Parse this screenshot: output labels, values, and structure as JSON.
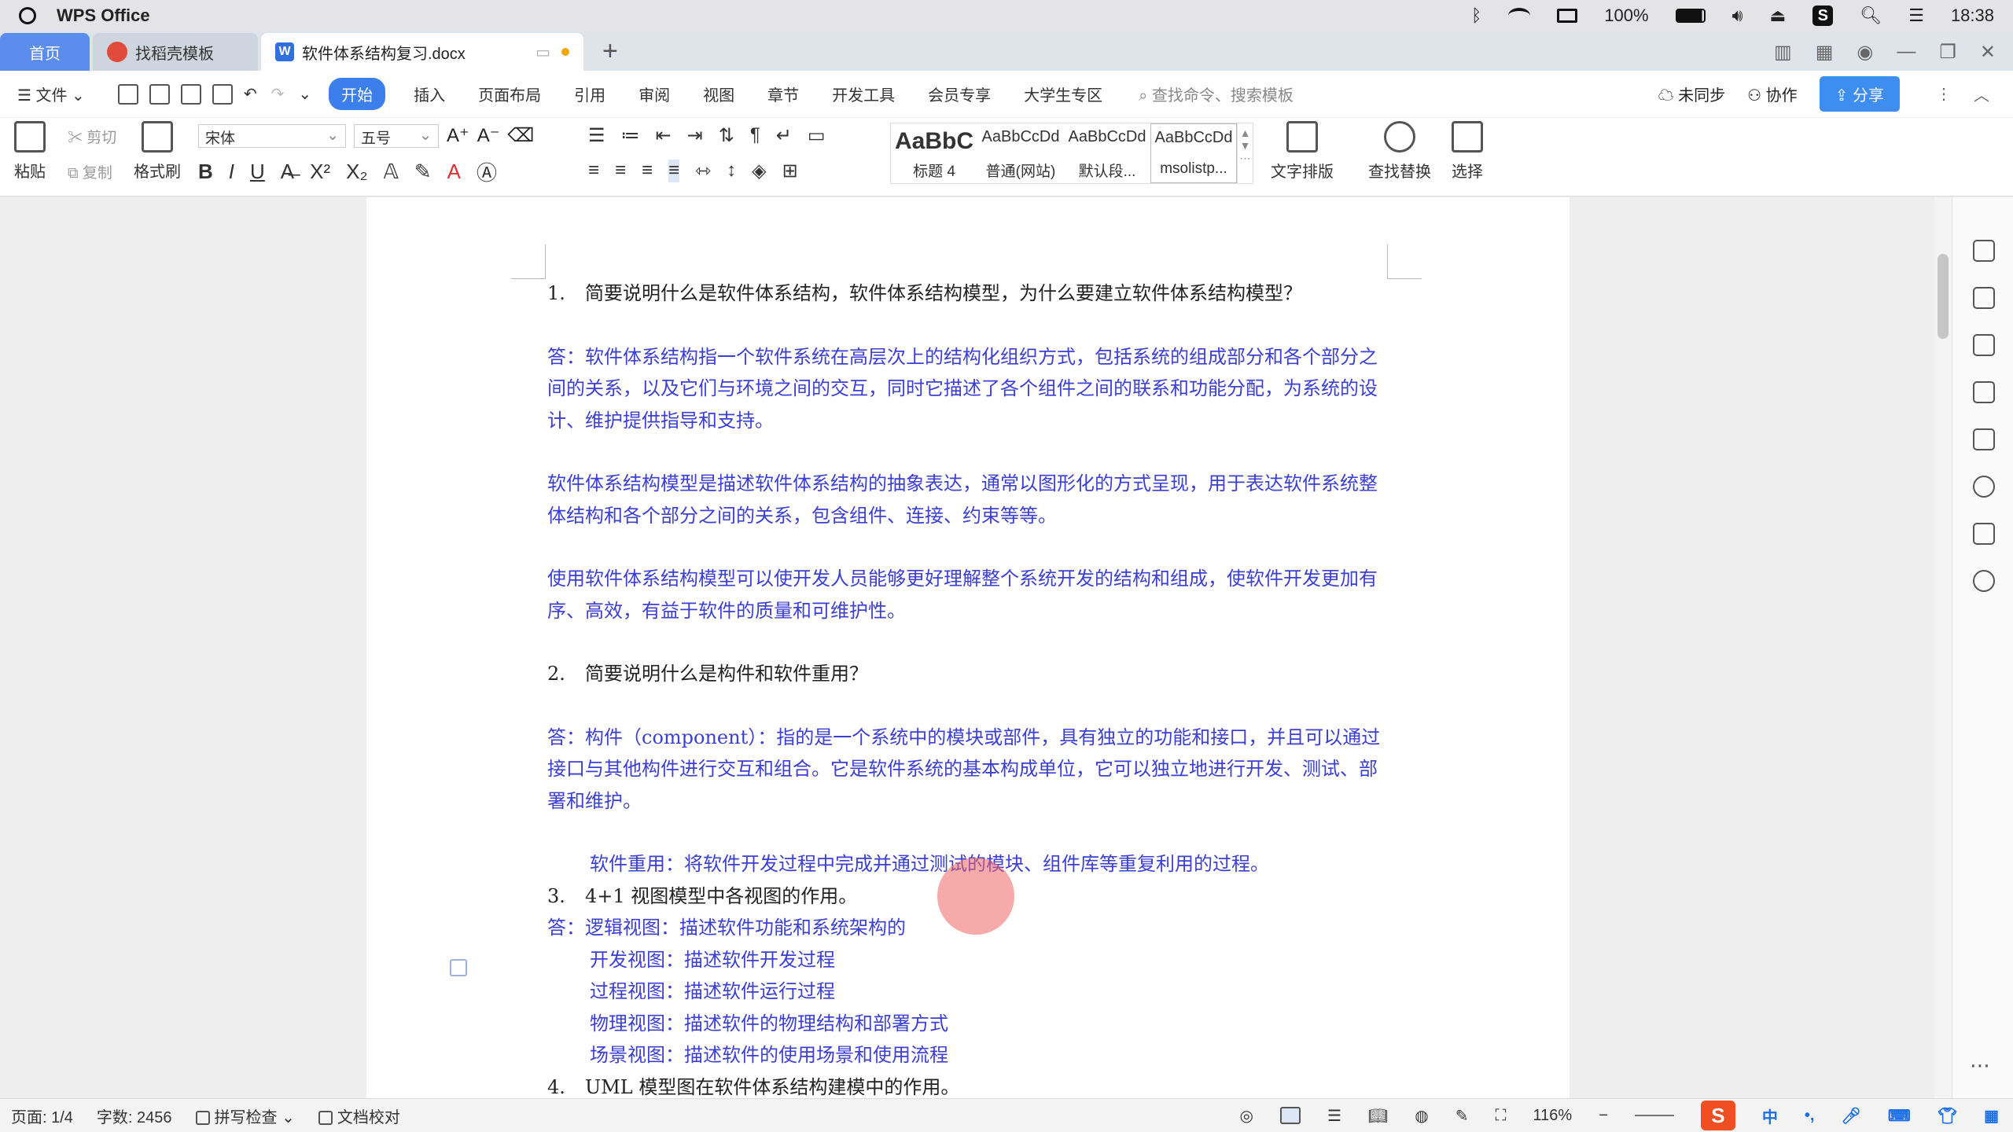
{
  "menubar": {
    "app_name": "WPS Office",
    "battery": "100%",
    "clock": "18:38"
  },
  "tabs": {
    "home": "首页",
    "template": "找稻壳模板",
    "document": "软件体系结构复习.docx",
    "plus": "+"
  },
  "menu": {
    "file": "文件",
    "items": [
      "开始",
      "插入",
      "页面布局",
      "引用",
      "审阅",
      "视图",
      "章节",
      "开发工具",
      "会员专享",
      "大学生专区"
    ],
    "search_placeholder": "查找命令、搜索模板",
    "sync": "未同步",
    "collab": "协作",
    "share": "分享"
  },
  "ribbon": {
    "paste": "粘贴",
    "cut": "剪切",
    "copy": "复制",
    "format_painter": "格式刷",
    "font_name": "宋体",
    "font_size": "五号",
    "styles": [
      {
        "sample": "AaBbC",
        "name": "标题 4"
      },
      {
        "sample": "AaBbCcDd",
        "name": "普通(网站)"
      },
      {
        "sample": "AaBbCcDd",
        "name": "默认段..."
      },
      {
        "sample": "AaBbCcDd",
        "name": "msolistp..."
      }
    ],
    "text_layout": "文字排版",
    "find_replace": "查找替换",
    "select": "选择"
  },
  "document": {
    "q1": "简要说明什么是软件体系结构，软件体系结构模型，为什么要建立软件体系结构模型？",
    "q1_num": "1.",
    "a1_p1": "答：软件体系结构指一个软件系统在高层次上的结构化组织方式，包括系统的组成部分和各个部分之间的关系，以及它们与环境之间的交互，同时它描述了各个组件之间的联系和功能分配，为系统的设计、维护提供指导和支持。",
    "a1_p2": "软件体系结构模型是描述软件体系结构的抽象表达，通常以图形化的方式呈现，用于表达软件系统整体结构和各个部分之间的关系，包含组件、连接、约束等等。",
    "a1_p3": "使用软件体系结构模型可以使开发人员能够更好理解整个系统开发的结构和组成，使软件开发更加有序、高效，有益于软件的质量和可维护性。",
    "q2_num": "2.",
    "q2": "简要说明什么是构件和软件重用？",
    "a2_p1": "答：构件（component）：指的是一个系统中的模块或部件，具有独立的功能和接口，并且可以通过接口与其他构件进行交互和组合。它是软件系统的基本构成单位，它可以独立地进行开发、测试、部署和维护。",
    "a2_p2": "软件重用：将软件开发过程中完成并通过测试的模块、组件库等重复利用的过程。",
    "q3_num": "3.",
    "q3": "4+1 视图模型中各视图的作用。",
    "a3_items": [
      "答：逻辑视图：描述软件功能和系统架构的",
      "开发视图：描述软件开发过程",
      "过程视图：描述软件运行过程",
      "物理视图：描述软件的物理结构和部署方式",
      "场景视图：描述软件的使用场景和使用流程"
    ],
    "q4_num": "4.",
    "q4": "UML 模型图在软件体系结构建模中的作用。"
  },
  "status": {
    "page": "页面: 1/4",
    "words": "字数: 2456",
    "spell": "拼写检查",
    "proof": "文档校对",
    "zoom": "116%",
    "ime": "中"
  }
}
